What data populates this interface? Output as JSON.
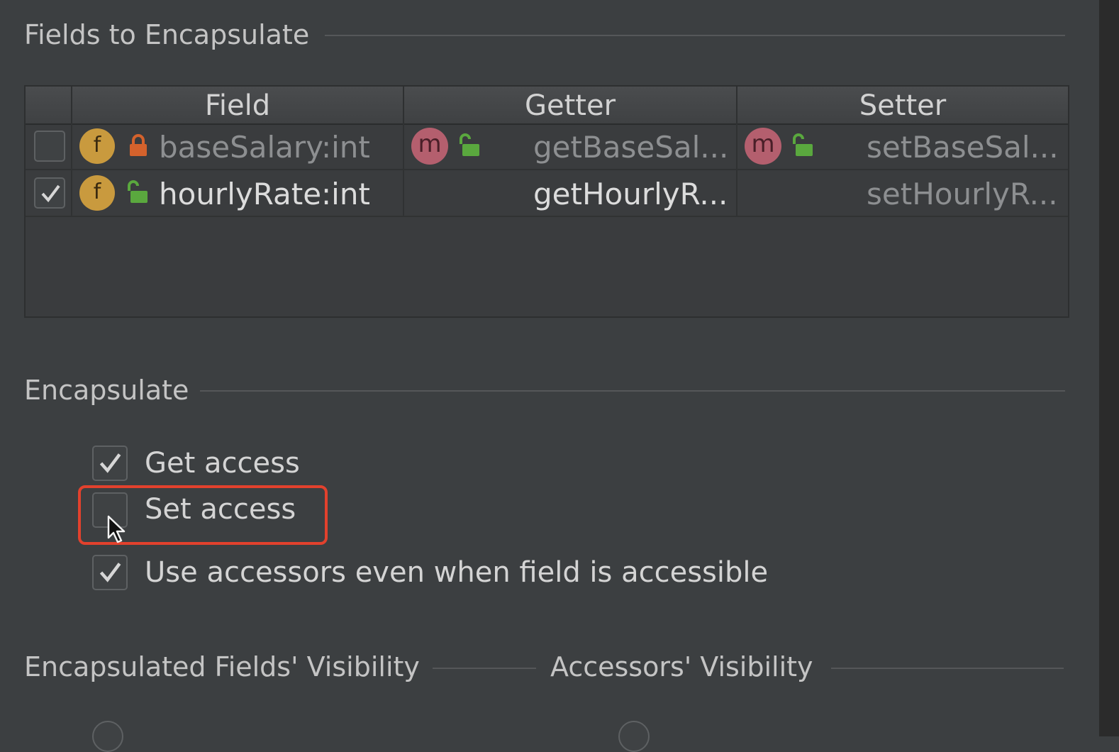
{
  "fields_group": {
    "title": "Fields to Encapsulate"
  },
  "table": {
    "headers": {
      "field": "Field",
      "getter": "Getter",
      "setter": "Setter"
    },
    "rows": [
      {
        "checked": false,
        "field_icon": "f",
        "lock_icon": "lock-closed-icon",
        "field": "baseSalary:int",
        "getter_icon": "m",
        "getter": "getBaseSal...",
        "setter_icon": "m",
        "setter": "setBaseSal..."
      },
      {
        "checked": true,
        "field_icon": "f",
        "lock_icon": "lock-open-icon",
        "field": "hourlyRate:int",
        "getter": "getHourlyR...",
        "setter": "setHourlyR..."
      }
    ]
  },
  "encapsulate_group": {
    "title": "Encapsulate",
    "options": [
      {
        "label": "Get access",
        "checked": true
      },
      {
        "label": "Set access",
        "checked": false
      },
      {
        "label": "Use accessors even when field is accessible",
        "checked": true
      }
    ]
  },
  "visibility": {
    "fields_title": "Encapsulated Fields' Visibility",
    "accessors_title": "Accessors' Visibility"
  },
  "colors": {
    "background": "#3c3f41",
    "field_badge": "#c99a3e",
    "method_badge": "#b45f6e",
    "lock_closed": "#d4622c",
    "lock_open": "#5aa83e",
    "highlight": "#e2412d"
  }
}
